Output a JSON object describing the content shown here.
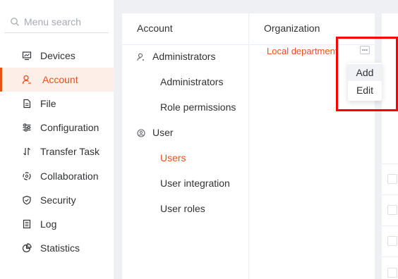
{
  "sidebar": {
    "search": {
      "placeholder": "Menu search",
      "value": ""
    },
    "items": [
      {
        "label": "Devices",
        "icon": "monitor-icon"
      },
      {
        "label": "Account",
        "icon": "user-icon",
        "active": true
      },
      {
        "label": "File",
        "icon": "file-icon"
      },
      {
        "label": "Configuration",
        "icon": "sliders-icon"
      },
      {
        "label": "Transfer Task",
        "icon": "transfer-icon"
      },
      {
        "label": "Collaboration",
        "icon": "collaboration-icon"
      },
      {
        "label": "Security",
        "icon": "shield-icon"
      },
      {
        "label": "Log",
        "icon": "log-icon"
      },
      {
        "label": "Statistics",
        "icon": "pie-chart-icon"
      }
    ]
  },
  "account_panel": {
    "header": "Account",
    "groups": [
      {
        "label": "Administrators",
        "icon": "admin-icon",
        "children": [
          "Administrators",
          "Role permissions"
        ]
      },
      {
        "label": "User",
        "icon": "user-circle-icon",
        "children": [
          "Users",
          "User integration",
          "User roles"
        ],
        "active_child": "Users"
      }
    ]
  },
  "org_panel": {
    "header": "Organization",
    "node": "Local department",
    "more_icon": "more-icon",
    "menu": [
      "Add",
      "Edit"
    ],
    "hover_item": "Add"
  },
  "colors": {
    "accent": "#e8501d",
    "highlight": "#ff0000",
    "active_bg": "#fdeee8"
  }
}
